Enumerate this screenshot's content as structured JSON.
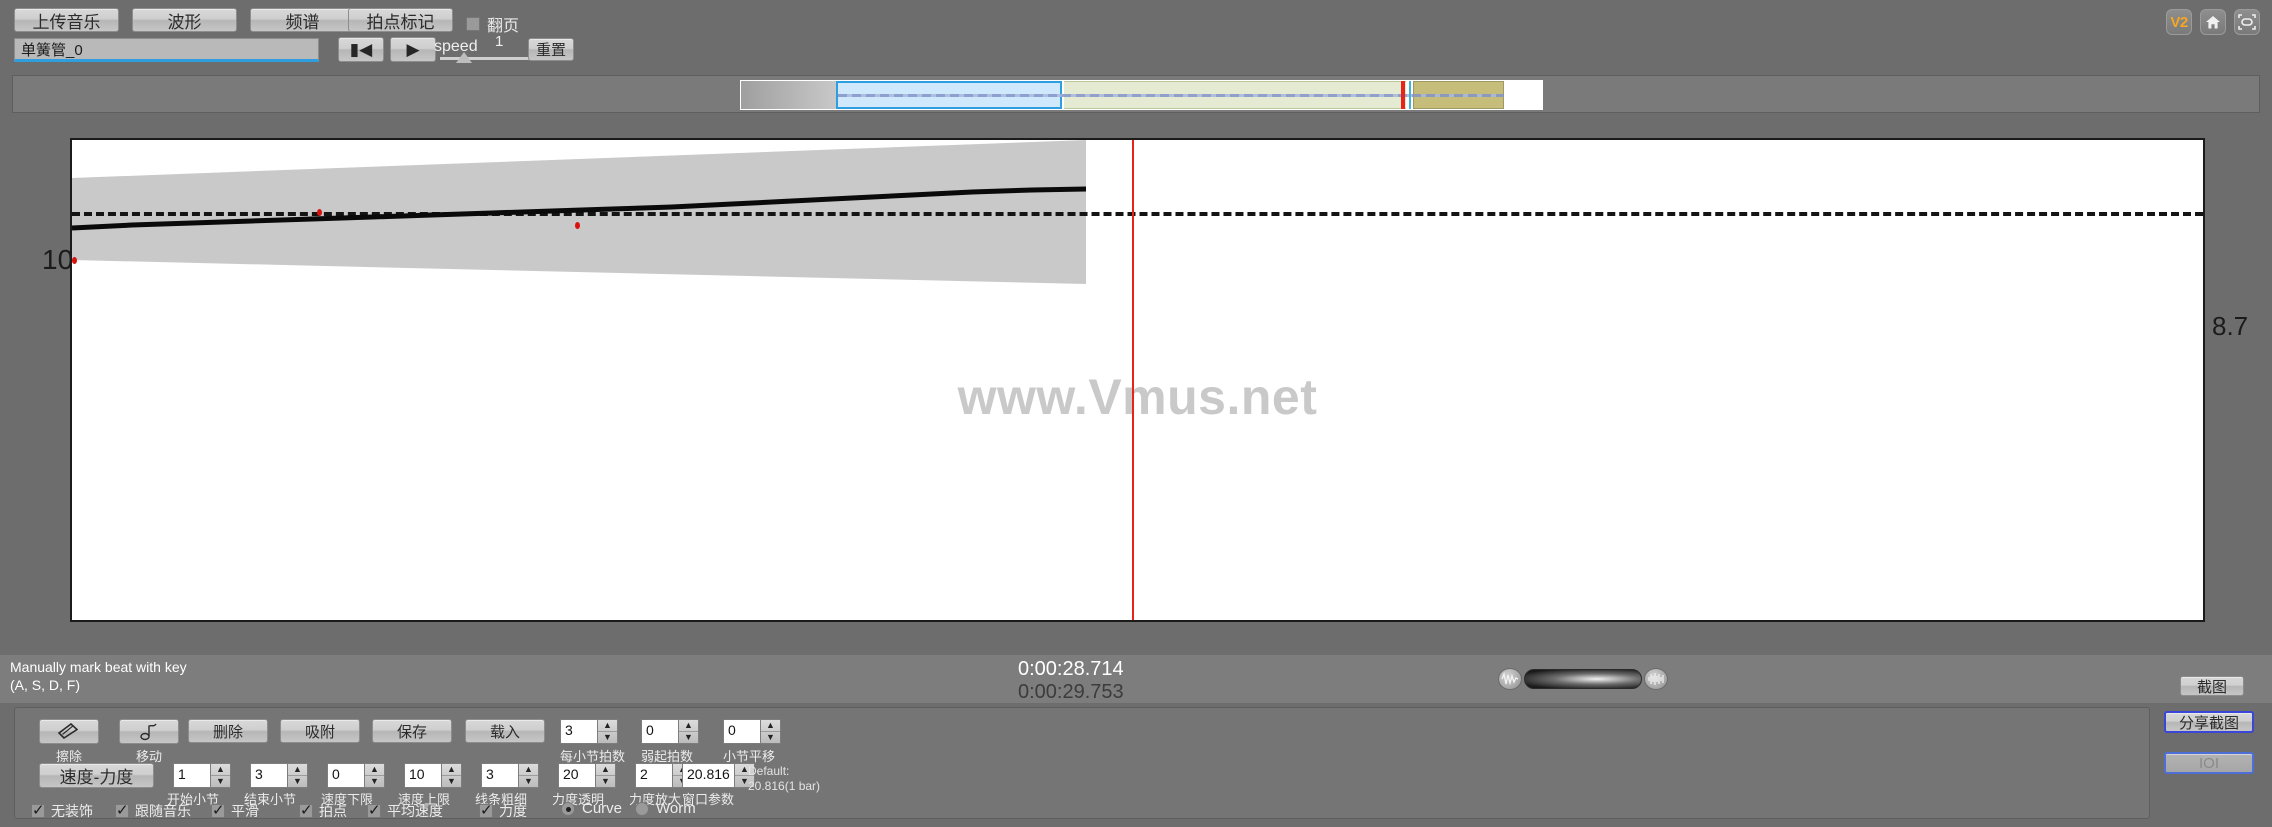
{
  "toolbar": {
    "buttons": [
      {
        "label": "上传音乐"
      },
      {
        "label": "波形"
      },
      {
        "label": "频谱"
      },
      {
        "label": "拍点标记"
      }
    ],
    "flip_checkbox": {
      "label": "翻页",
      "checked": false
    },
    "track_name": "单簧管_0",
    "rewind_icon": "rewind-to-start-icon",
    "play_icon": "play-icon",
    "speed_label": "speed",
    "speed_value": "1",
    "reset_label": "重置",
    "corner_icons": [
      {
        "name": "version-badge",
        "label": "V2"
      },
      {
        "name": "home-icon",
        "label": "⌂"
      },
      {
        "name": "fullscreen-icon",
        "label": "⤢"
      }
    ]
  },
  "status": {
    "hint_line1": "Manually mark beat with key",
    "hint_line2": "(A, S, D, F)",
    "time_current": "0:00:28.714",
    "time_total": "0:00:29.753",
    "capture_label": "截图",
    "audio_left_icon": "waveform-icon",
    "audio_right_icon": "audio-spectrum-icon"
  },
  "controls": {
    "erase_button": {
      "label": "擦除",
      "icon": "eraser-icon"
    },
    "move_button": {
      "label": "移动",
      "icon": "move-note-icon"
    },
    "wide_buttons": [
      {
        "label": "删除"
      },
      {
        "label": "吸附"
      },
      {
        "label": "保存"
      },
      {
        "label": "载入"
      }
    ],
    "speed_force_label": "速度-力度",
    "spinners_row1": [
      {
        "caption": "每小节拍数",
        "value": "3"
      },
      {
        "caption": "弱起拍数",
        "value": "0"
      },
      {
        "caption": "小节平移",
        "value": "0"
      }
    ],
    "spinners_row2": [
      {
        "caption": "开始小节",
        "value": "1"
      },
      {
        "caption": "结束小节",
        "value": "3"
      },
      {
        "caption": "速度下限",
        "value": "0"
      },
      {
        "caption": "速度上限",
        "value": "10"
      },
      {
        "caption": "线条粗细",
        "value": "3"
      },
      {
        "caption": "力度透明",
        "value": "20"
      },
      {
        "caption": "力度放大",
        "value": "2"
      },
      {
        "caption": "窗口参数",
        "value": "20.816"
      }
    ],
    "default_note_line1": "Default:",
    "default_note_line2": "20.816(1 bar)",
    "checkboxes": [
      {
        "label": "无装饰",
        "checked": true
      },
      {
        "label": "跟随音乐",
        "checked": true
      },
      {
        "label": "平滑",
        "checked": true
      },
      {
        "label": "拍点",
        "checked": true
      },
      {
        "label": "平均速度",
        "checked": true
      },
      {
        "label": "力度",
        "checked": true
      }
    ],
    "radios": [
      {
        "label": "Curve",
        "selected": true
      },
      {
        "label": "Worm",
        "selected": false
      }
    ],
    "share_label": "分享截图",
    "third_label": "IOI"
  },
  "chart_data": {
    "type": "line",
    "title": "",
    "watermark": "www.Vmus.net",
    "xlabel": "",
    "ylabel": "",
    "xlim": [
      1,
      3
    ],
    "ylim": [
      0,
      10
    ],
    "xticks": [
      "1",
      "2",
      "3"
    ],
    "yticks": [
      "0",
      "10"
    ],
    "grid": false,
    "reference_line": {
      "value": "8.7",
      "style": "dashed",
      "color": "#141414"
    },
    "playhead_x": 2.0,
    "series": [
      {
        "name": "tempo-curve",
        "color": "#000000",
        "x": [
          1.0,
          1.1,
          1.2,
          1.3,
          1.4,
          1.5,
          1.6,
          1.7,
          1.8,
          1.9,
          1.95
        ],
        "y": [
          8.42,
          8.47,
          8.52,
          8.58,
          8.63,
          8.68,
          8.74,
          8.8,
          8.86,
          8.92,
          8.95
        ]
      },
      {
        "name": "dynamics-band-upper",
        "color": "#c8c8c8",
        "x": [
          1.0,
          1.95
        ],
        "y": [
          9.1,
          9.92
        ]
      },
      {
        "name": "dynamics-band-lower",
        "color": "#c8c8c8",
        "x": [
          1.0,
          1.95
        ],
        "y": [
          7.05,
          7.0
        ]
      }
    ],
    "markers": [
      {
        "name": "beat-marker",
        "x": 1.0,
        "y": 7.0,
        "color": "#d8120c"
      },
      {
        "name": "beat-marker",
        "x": 1.21,
        "y": 8.53,
        "color": "#d8120c"
      },
      {
        "name": "beat-marker",
        "x": 1.43,
        "y": 8.37,
        "color": "#d8120c"
      }
    ]
  },
  "scrubber": {
    "segments": [
      {
        "name": "pre-roll",
        "color": "#c8c8c8"
      },
      {
        "name": "selection-blue",
        "color": "#cfe8fb"
      },
      {
        "name": "region-green",
        "color": "#e4ebd2"
      },
      {
        "name": "region-olive",
        "color": "#c5bd79"
      }
    ],
    "playhead_color": "#e8241a"
  }
}
